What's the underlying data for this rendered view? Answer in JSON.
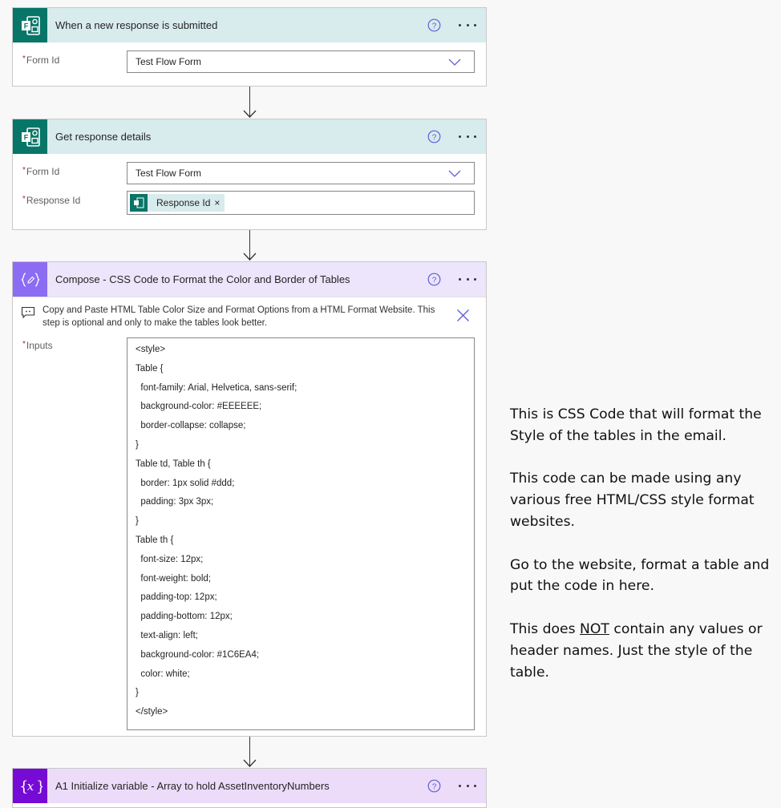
{
  "steps": [
    {
      "title": "When a new response is submitted",
      "type": "forms",
      "fields": [
        {
          "label": "Form Id",
          "required": true,
          "value": "Test Flow Form",
          "kind": "dropdown"
        }
      ]
    },
    {
      "title": "Get response details",
      "type": "forms",
      "fields": [
        {
          "label": "Form Id",
          "required": true,
          "value": "Test Flow Form",
          "kind": "dropdown"
        },
        {
          "label": "Response Id",
          "required": true,
          "token": "Response Id",
          "kind": "token"
        }
      ]
    },
    {
      "title": "Compose - CSS Code to Format the Color and Border of Tables",
      "type": "compose",
      "comment": "Copy and Paste HTML Table Color Size and Format Options from a HTML Format Website. This step is optional and only to make the tables look better.",
      "fields": [
        {
          "label": "Inputs",
          "required": true,
          "kind": "code",
          "lines": [
            "<style>",
            "Table {",
            "  font-family: Arial, Helvetica, sans-serif;",
            "  background-color: #EEEEEE;",
            "  border-collapse: collapse;",
            "}",
            "Table td, Table th {",
            "  border: 1px solid #ddd;",
            "  padding: 3px 3px;",
            "}",
            "Table th {",
            "  font-size: 12px;",
            "  font-weight: bold;",
            "  padding-top: 12px;",
            "  padding-bottom: 12px;",
            "  text-align: left;",
            "  background-color: #1C6EA4;",
            "  color: white;",
            "}",
            "</style>"
          ]
        }
      ]
    },
    {
      "title": "A1 Initialize variable - Array to hold AssetInventoryNumbers",
      "type": "variable"
    }
  ],
  "required_marker": "*",
  "token_remove_glyph": "×",
  "annotation": {
    "paragraph1": "This is CSS Code that will format the Style of the tables in the email.",
    "paragraph2": "This code can be made using any various free HTML/CSS style format websites.",
    "paragraph3": "Go to the website, format a table and put the code in here.",
    "paragraph4_before": "This does ",
    "paragraph4_underlined": "NOT",
    "paragraph4_after": " contain any values or header names. Just the style of the table."
  },
  "icons": {
    "forms": "microsoft-forms-icon",
    "compose": "compose-braces-pencil-icon",
    "variable": "variable-x-icon",
    "help": "question-circle-icon",
    "more": "ellipsis-icon",
    "dropdown": "chevron-down-icon",
    "comment": "speech-bubble-icon",
    "close": "close-x-icon"
  },
  "colors": {
    "forms_brand": "#077568",
    "forms_header": "#d8ebed",
    "compose_brand": "#8c6cf2",
    "compose_header": "#ece5fb",
    "variable_brand": "#770bd6",
    "variable_header": "#ecdcfa",
    "accent_icon": "#605ed8",
    "required": "#a4262c"
  }
}
